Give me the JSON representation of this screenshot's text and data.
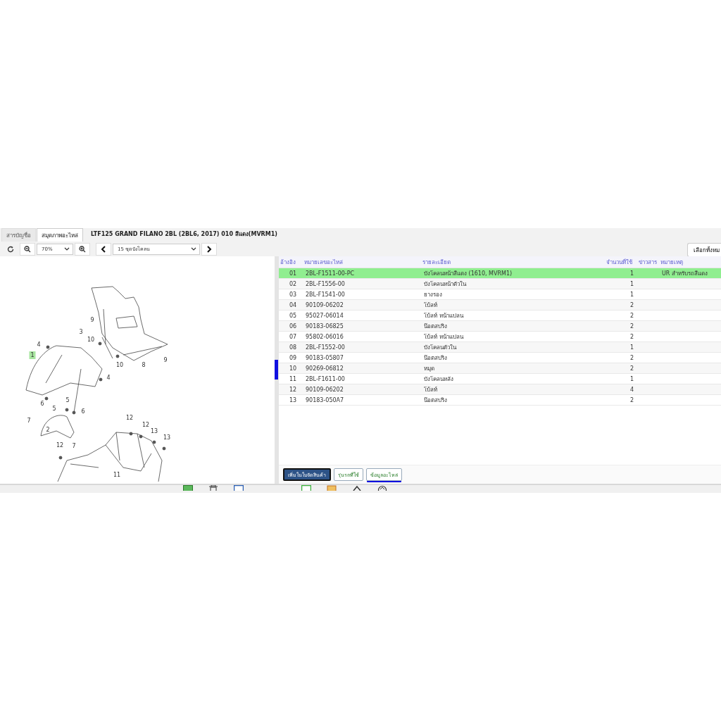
{
  "tabs": [
    {
      "label": "สารบัญชื่อ",
      "selected": false
    },
    {
      "label": "สมุดภาพอะไหล่",
      "selected": true
    }
  ],
  "title": "LTF125 GRAND FILANO 2BL (2BL6, 2017) 010 สีแดง(MVRM1)",
  "toolbar": {
    "zoom": "70%",
    "group": "15 ชุดบังโคลน",
    "select_all": "เลือกทั้งหม"
  },
  "diagram": {
    "callouts": [
      {
        "label": "3",
        "selected": false
      },
      {
        "label": "4",
        "selected": false
      },
      {
        "label": "1",
        "selected": true
      },
      {
        "label": "4",
        "selected": false
      },
      {
        "label": "6",
        "selected": false
      },
      {
        "label": "5",
        "selected": false
      },
      {
        "label": "5",
        "selected": false
      },
      {
        "label": "6",
        "selected": false
      },
      {
        "label": "7",
        "selected": false
      },
      {
        "label": "2",
        "selected": false
      },
      {
        "label": "7",
        "selected": false
      },
      {
        "label": "9",
        "selected": false
      },
      {
        "label": "10",
        "selected": false
      },
      {
        "label": "10",
        "selected": false
      },
      {
        "label": "8",
        "selected": false
      },
      {
        "label": "9",
        "selected": false
      },
      {
        "label": "12",
        "selected": false
      },
      {
        "label": "12",
        "selected": false
      },
      {
        "label": "13",
        "selected": false
      },
      {
        "label": "13",
        "selected": false
      },
      {
        "label": "12",
        "selected": false
      },
      {
        "label": "11",
        "selected": false
      }
    ]
  },
  "table": {
    "columns": [
      "อ้างอิง",
      "หมายเลขอะไหล่",
      "รายละเอียด",
      "จำนวนที่ใช้",
      "ข่าวสาร",
      "หมายเหตุ"
    ],
    "rows": [
      {
        "ref": "01",
        "part_no": "2BL-F1511-00-PC",
        "description": "บังโคลนหน้าสีแดง (1610, MVRM1)",
        "qty": "1",
        "remark": "UR สำหรับรถสีแดง",
        "selected": true
      },
      {
        "ref": "02",
        "part_no": "2BL-F1556-00",
        "description": "บังโคลนหน้าตัวใน",
        "qty": "1",
        "selected": false
      },
      {
        "ref": "03",
        "part_no": "2BL-F1541-00",
        "description": "ยางรอง",
        "qty": "1",
        "selected": false
      },
      {
        "ref": "04",
        "part_no": "90109-06202",
        "description": "โบ้ลท์",
        "qty": "2",
        "selected": false
      },
      {
        "ref": "05",
        "part_no": "95027-06014",
        "description": "โบ้ลท์ หน้าแปลน",
        "qty": "2",
        "selected": false
      },
      {
        "ref": "06",
        "part_no": "90183-06825",
        "description": "น๊อตสปริง",
        "qty": "2",
        "selected": false
      },
      {
        "ref": "07",
        "part_no": "95802-06016",
        "description": "โบ้ลท์ หน้าแปลน",
        "qty": "2",
        "selected": false
      },
      {
        "ref": "08",
        "part_no": "2BL-F1552-00",
        "description": "บังโคลนตัวใน",
        "qty": "1",
        "selected": false
      },
      {
        "ref": "09",
        "part_no": "90183-05807",
        "description": "น๊อตสปริง",
        "qty": "2",
        "selected": false
      },
      {
        "ref": "10",
        "part_no": "90269-06812",
        "description": "หมุด",
        "qty": "2",
        "selected": false
      },
      {
        "ref": "11",
        "part_no": "2BL-F1611-00",
        "description": "บังโคลนหลัง",
        "qty": "1",
        "selected": false
      },
      {
        "ref": "12",
        "part_no": "90109-06202",
        "description": "โบ้ลท์",
        "qty": "4",
        "selected": false
      },
      {
        "ref": "13",
        "part_no": "90183-050A7",
        "description": "น๊อตสปริง",
        "qty": "2",
        "selected": false
      }
    ]
  },
  "actions": [
    {
      "label": "เพิ่มในใบจัดสินค้า",
      "kind": "primary",
      "selected": false
    },
    {
      "label": "รุ่นรถที่ใช้",
      "kind": "tab",
      "selected": false
    },
    {
      "label": "ข้อมูลอะไหล่",
      "kind": "tab",
      "selected": true
    }
  ]
}
